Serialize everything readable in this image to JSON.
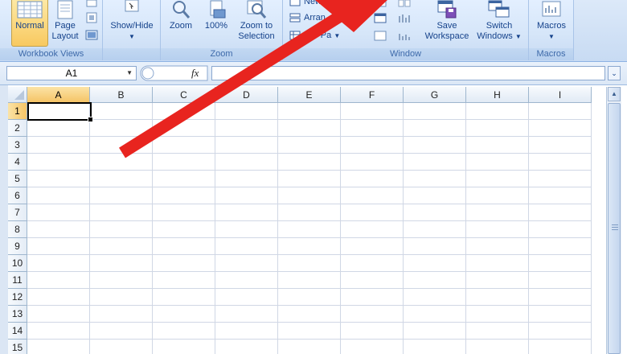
{
  "ribbon": {
    "workbook_views": {
      "label": "Workbook Views",
      "normal": "Normal",
      "page_layout_line1": "Page",
      "page_layout_line2": "Layout"
    },
    "show_hide": {
      "label": "Show/Hide"
    },
    "zoom": {
      "label": "Zoom",
      "zoom_btn": "Zoom",
      "hundred_btn": "100%",
      "zoom_sel_line1": "Zoom to",
      "zoom_sel_line2": "Selection"
    },
    "window": {
      "label": "Window",
      "new_window": "New",
      "arrange_all": "Arran",
      "freeze_panes": "eze Pa",
      "save_ws_line1": "Save",
      "save_ws_line2": "Workspace",
      "switch_line1": "Switch",
      "switch_line2": "Windows"
    },
    "macros": {
      "label": "Macros",
      "macros_btn": "Macros"
    }
  },
  "formula_bar": {
    "name_box": "A1",
    "fx": "fx",
    "formula_value": ""
  },
  "grid": {
    "columns": [
      "A",
      "B",
      "C",
      "D",
      "E",
      "F",
      "G",
      "H",
      "I"
    ],
    "rows": [
      "1",
      "2",
      "3",
      "4",
      "5",
      "6",
      "7",
      "8",
      "9",
      "10",
      "11",
      "12",
      "13",
      "14",
      "15"
    ],
    "active_cell": "A1"
  },
  "colors": {
    "annotation_arrow": "#e8241f",
    "ribbon_bg": "#d6e6f9",
    "selection_header": "#f5c466"
  }
}
